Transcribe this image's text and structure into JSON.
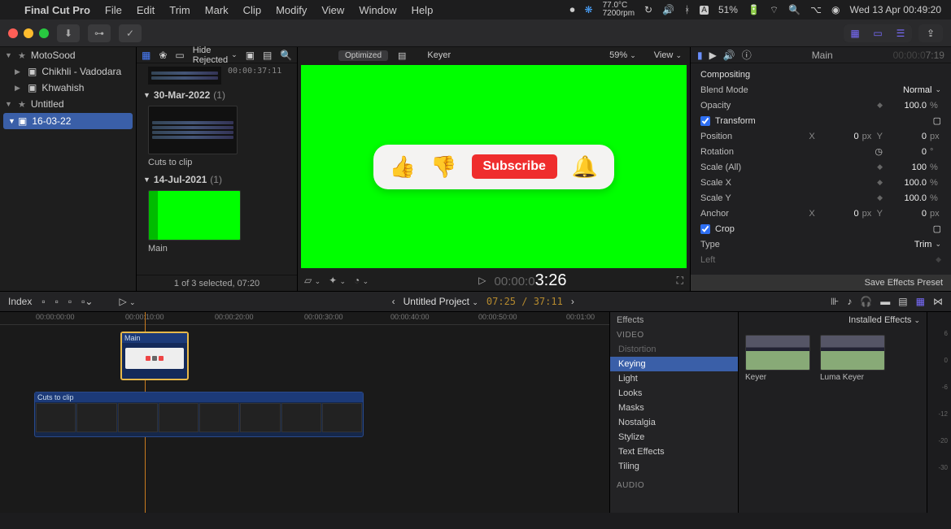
{
  "menubar": {
    "app": "Final Cut Pro",
    "items": [
      "File",
      "Edit",
      "Trim",
      "Mark",
      "Clip",
      "Modify",
      "View",
      "Window",
      "Help"
    ],
    "temp_top": "77.0°C",
    "temp_bot": "7200rpm",
    "battery": "51%",
    "datetime": "Wed 13 Apr  00:49:20"
  },
  "sidebar": {
    "items": [
      {
        "label": "MotoSood",
        "star": true,
        "disclose": true
      },
      {
        "label": "Chikhli - Vadodara",
        "sub": true
      },
      {
        "label": "Khwahish",
        "sub": true
      },
      {
        "label": "Untitled",
        "star": true,
        "disclose": true
      },
      {
        "label": "16-03-22",
        "sub": true,
        "selected": true
      }
    ]
  },
  "browser": {
    "hide_label": "Hide Rejected",
    "top_tc": "00:00:37:11",
    "events": [
      {
        "title": "30-Mar-2022",
        "count": "(1)",
        "clip_label": "Cuts to clip",
        "thumb": "dark"
      },
      {
        "title": "14-Jul-2021",
        "count": "(1)",
        "clip_label": "Main",
        "thumb": "green"
      }
    ],
    "status": "1 of 3 selected, 07:20"
  },
  "viewer": {
    "badge": "Optimized",
    "clip": "Keyer",
    "zoom": "59%",
    "view_label": "View",
    "subscribe": "Subscribe",
    "tc_prefix": "00:00:0",
    "tc_main": "3:26"
  },
  "inspector": {
    "tabs_title": "Main",
    "duration": "7:19",
    "sections": {
      "compositing": "Compositing",
      "blend": "Blend Mode",
      "blend_val": "Normal",
      "opacity": "Opacity",
      "opacity_val": "100.0",
      "transform": "Transform",
      "position": "Position",
      "pos_x": "0",
      "pos_y": "0",
      "rotation": "Rotation",
      "rot_val": "0",
      "scale_all": "Scale (All)",
      "scale_all_val": "100",
      "scale_x": "Scale X",
      "scale_x_val": "100.0",
      "scale_y": "Scale Y",
      "scale_y_val": "100.0",
      "anchor": "Anchor",
      "anc_x": "0",
      "anc_y": "0",
      "crop": "Crop",
      "type": "Type",
      "type_val": "Trim",
      "left": "Left"
    },
    "save": "Save Effects Preset"
  },
  "timeline_head": {
    "index": "Index",
    "proj": "Untitled Project",
    "time": "07:25 / 37:11"
  },
  "timeline": {
    "ruler": [
      "00:00:00:00",
      "00:00:10:00",
      "00:00:20:00",
      "00:00:30:00",
      "00:00:40:00",
      "00:00:50:00",
      "00:01:00"
    ],
    "clip_main": "Main",
    "clip_cuts": "Cuts to clip"
  },
  "effects": {
    "panel": "Effects",
    "installed": "Installed Effects",
    "video_hdr": "VIDEO",
    "audio_hdr": "AUDIO",
    "cats": [
      "Distortion",
      "Keying",
      "Light",
      "Looks",
      "Masks",
      "Nostalgia",
      "Stylize",
      "Text Effects",
      "Tiling"
    ],
    "selected": "Keying",
    "items": [
      {
        "name": "Keyer"
      },
      {
        "name": "Luma Keyer"
      }
    ],
    "db": [
      "6",
      "0",
      "-6",
      "-12",
      "-20",
      "-30"
    ]
  }
}
